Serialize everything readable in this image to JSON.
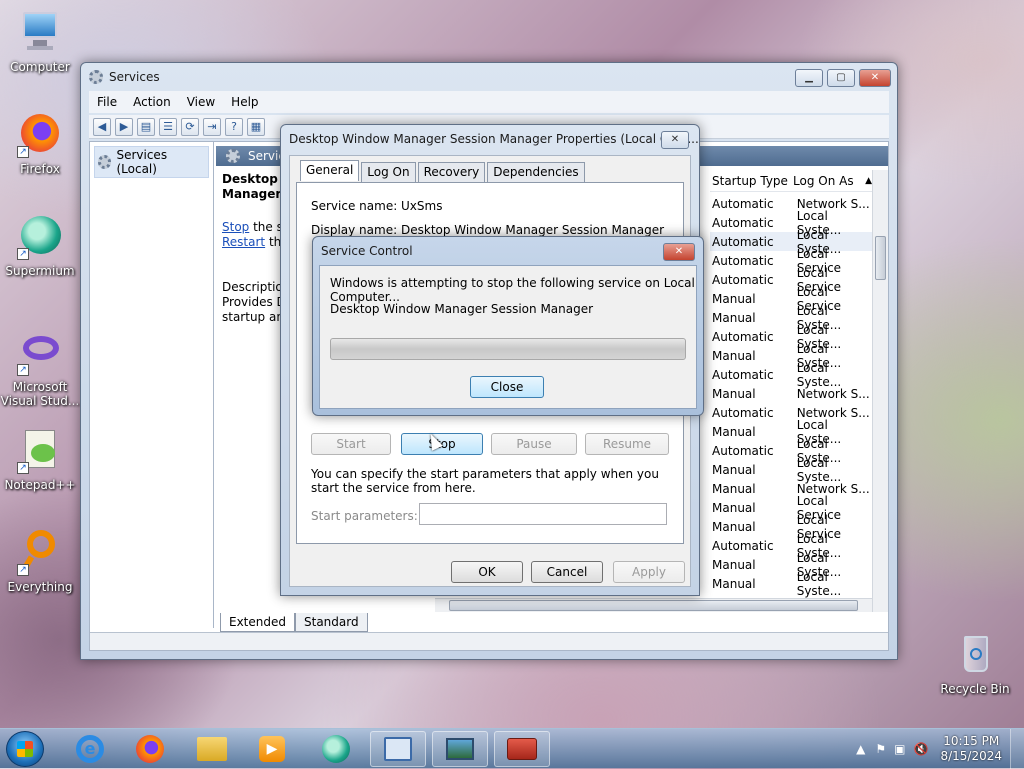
{
  "desktop": {
    "icons": [
      {
        "label": "Computer",
        "icon": "computer-icon"
      },
      {
        "label": "Firefox",
        "icon": "firefox-icon"
      },
      {
        "label": "Supermium",
        "icon": "supermium-icon"
      },
      {
        "label": "Microsoft Visual Stud...",
        "icon": "visual-studio-icon"
      },
      {
        "label": "Notepad++",
        "icon": "notepadpp-icon"
      },
      {
        "label": "Everything",
        "icon": "everything-icon"
      },
      {
        "label": "Recycle Bin",
        "icon": "recycle-bin-icon"
      }
    ]
  },
  "services_window": {
    "title": "Services",
    "menu": [
      "File",
      "Action",
      "View",
      "Help"
    ],
    "tree_item": "Services (Local)",
    "header_label": "Servic",
    "selected_name": "Desktop W",
    "selected_name_line2": "Manager",
    "stop_link": "Stop",
    "stop_suffix": " the se",
    "restart_link": "Restart",
    "restart_suffix": " the",
    "description_label": "Description",
    "description_text": "Provides De",
    "description_text2": "startup and",
    "columns": {
      "startup": "Startup Type",
      "logon": "Log On As"
    },
    "rows": [
      {
        "startup": "Automatic",
        "logon": "Network S..."
      },
      {
        "startup": "Automatic",
        "logon": "Local Syste..."
      },
      {
        "startup": "Automatic",
        "logon": "Local Syste..."
      },
      {
        "startup": "Automatic",
        "logon": "Local Service"
      },
      {
        "startup": "Automatic",
        "logon": "Local Service"
      },
      {
        "startup": "Manual",
        "logon": "Local Service"
      },
      {
        "startup": "Manual",
        "logon": "Local Syste..."
      },
      {
        "startup": "Automatic",
        "logon": "Local Syste..."
      },
      {
        "startup": "Manual",
        "logon": "Local Syste..."
      },
      {
        "startup": "Automatic",
        "logon": "Local Syste..."
      },
      {
        "startup": "Manual",
        "logon": "Network S..."
      },
      {
        "startup": "Automatic",
        "logon": "Network S..."
      },
      {
        "startup": "Manual",
        "logon": "Local Syste..."
      },
      {
        "startup": "Automatic",
        "logon": "Local Syste..."
      },
      {
        "startup": "Manual",
        "logon": "Local Syste..."
      },
      {
        "startup": "Manual",
        "logon": "Network S..."
      },
      {
        "startup": "Manual",
        "logon": "Local Service"
      },
      {
        "startup": "Manual",
        "logon": "Local Service"
      },
      {
        "startup": "Automatic",
        "logon": "Local Syste..."
      },
      {
        "startup": "Manual",
        "logon": "Local Syste..."
      },
      {
        "startup": "Manual",
        "logon": "Local Syste..."
      }
    ],
    "tabs": [
      "Extended",
      "Standard"
    ]
  },
  "properties_dialog": {
    "title": "Desktop Window Manager Session Manager Properties (Local Com...",
    "tabs": [
      "General",
      "Log On",
      "Recovery",
      "Dependencies"
    ],
    "service_name_label": "Service name:",
    "service_name": "UxSms",
    "display_name_label": "Display name:",
    "display_name": "Desktop Window Manager Session Manager",
    "buttons": {
      "start": "Start",
      "stop": "Stop",
      "pause": "Pause",
      "resume": "Resume"
    },
    "params_note": "You can specify the start parameters that apply when you start the service from here.",
    "start_params_label": "Start parameters:",
    "ok": "OK",
    "cancel": "Cancel",
    "apply": "Apply"
  },
  "service_control": {
    "title": "Service Control",
    "message": "Windows is attempting to stop the following service on Local Computer...",
    "service": "Desktop Window Manager Session Manager",
    "close": "Close",
    "progress": 0
  },
  "taskbar": {
    "time": "10:15 PM",
    "date": "8/15/2024",
    "apps": [
      "internet-explorer-icon",
      "firefox-icon",
      "file-explorer-icon",
      "media-player-icon",
      "supermium-icon",
      "remote-desktop-icon",
      "screen-icon",
      "toolbox-icon"
    ]
  }
}
